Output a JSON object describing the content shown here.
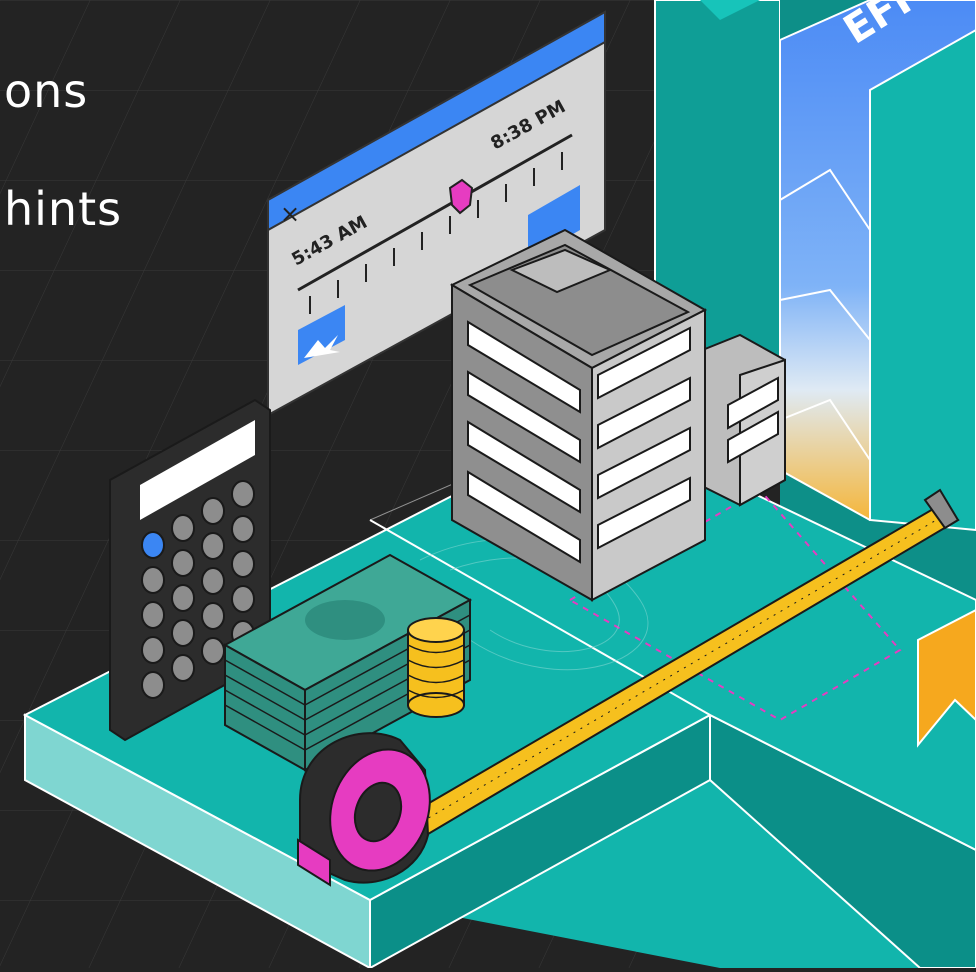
{
  "hero_text": {
    "line1": "ons",
    "line2": "hints"
  },
  "time_panel": {
    "start_time": "5:43 AM",
    "end_time": "8:38 PM",
    "close_glyph": "×"
  },
  "tower_lettering": "EFF",
  "icons": [
    "calculator-icon",
    "money-stack-icon",
    "coins-icon",
    "tape-measure-icon",
    "building-icon",
    "time-slider-panel",
    "bookmark-icon"
  ],
  "colors": {
    "background": "#232323",
    "teal": "#12b5ac",
    "teal_dark": "#0b8f88",
    "panel_blue": "#3b86f3",
    "magenta": "#e63cc1",
    "tape_yellow": "#f6c01e",
    "building_gray": "#c9c9c9"
  }
}
